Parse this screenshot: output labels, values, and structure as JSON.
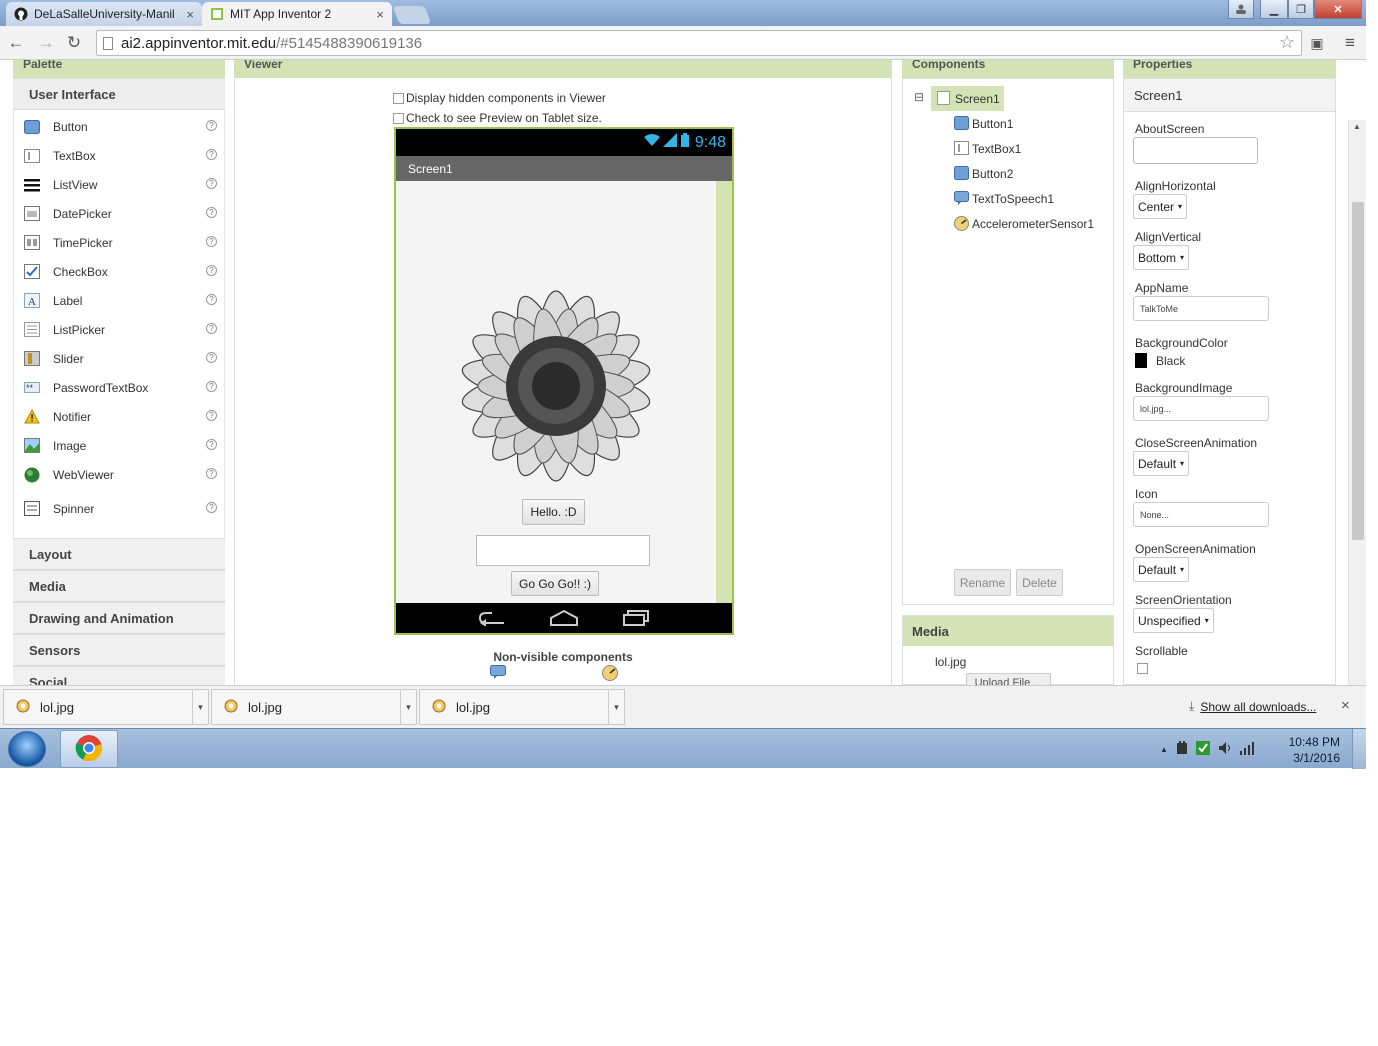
{
  "browser": {
    "tabs": [
      {
        "label": "DeLaSalleUniversity-Manil",
        "icon": "github-icon",
        "active": false
      },
      {
        "label": "MIT App Inventor 2",
        "icon": "appinventor-icon",
        "active": true
      }
    ],
    "tab_close": "×",
    "url_host": "ai2.appinventor.mit.edu",
    "url_rest": "/#5145488390619136"
  },
  "palette": {
    "title": "Palette",
    "open_category": "User Interface",
    "items": [
      {
        "label": "Button",
        "icon": "button-icon"
      },
      {
        "label": "TextBox",
        "icon": "textbox-icon"
      },
      {
        "label": "ListView",
        "icon": "listview-icon"
      },
      {
        "label": "DatePicker",
        "icon": "datepicker-icon"
      },
      {
        "label": "TimePicker",
        "icon": "timepicker-icon"
      },
      {
        "label": "CheckBox",
        "icon": "checkbox-icon"
      },
      {
        "label": "Label",
        "icon": "label-icon"
      },
      {
        "label": "ListPicker",
        "icon": "listpicker-icon"
      },
      {
        "label": "Slider",
        "icon": "slider-icon"
      },
      {
        "label": "PasswordTextBox",
        "icon": "passwordtextbox-icon"
      },
      {
        "label": "Notifier",
        "icon": "notifier-icon"
      },
      {
        "label": "Image",
        "icon": "image-icon"
      },
      {
        "label": "WebViewer",
        "icon": "webviewer-icon"
      },
      {
        "label": "Spinner",
        "icon": "spinner-icon"
      }
    ],
    "help": "?",
    "categories": [
      "Layout",
      "Media",
      "Drawing and Animation",
      "Sensors",
      "Social"
    ]
  },
  "viewer": {
    "title": "Viewer",
    "opt_hidden": "Display hidden components in Viewer",
    "opt_tablet": "Check to see Preview on Tablet size.",
    "status_time": "9:48",
    "screen_title": "Screen1",
    "button1": "Hello. :D",
    "textbox1": "",
    "button2": "Go Go Go!! :)",
    "nonvisible_title": "Non-visible components"
  },
  "components": {
    "title": "Components",
    "root": "Screen1",
    "collapse": "⊟",
    "children": [
      "Button1",
      "TextBox1",
      "Button2",
      "TextToSpeech1",
      "AccelerometerSensor1"
    ],
    "rename": "Rename",
    "delete": "Delete"
  },
  "media": {
    "title": "Media",
    "file": "lol.jpg",
    "upload": "Upload File ..."
  },
  "properties": {
    "title": "Properties",
    "component": "Screen1",
    "about_label": "AboutScreen",
    "about_value": "",
    "alignh_label": "AlignHorizontal",
    "alignh_value": "Center",
    "alignv_label": "AlignVertical",
    "alignv_value": "Bottom",
    "appname_label": "AppName",
    "appname_value": "TalkToMe",
    "bgcolor_label": "BackgroundColor",
    "bgcolor_value": "Black",
    "bgcolor_hex": "#000000",
    "bgimage_label": "BackgroundImage",
    "bgimage_value": "lol.jpg...",
    "closeanim_label": "CloseScreenAnimation",
    "closeanim_value": "Default",
    "icon_label": "Icon",
    "icon_value": "None...",
    "openanim_label": "OpenScreenAnimation",
    "openanim_value": "Default",
    "orientation_label": "ScreenOrientation",
    "orientation_value": "Unspecified",
    "scrollable_label": "Scrollable"
  },
  "downloads": {
    "items": [
      "lol.jpg",
      "lol.jpg",
      "lol.jpg"
    ],
    "show_all": "Show all downloads...",
    "close": "×"
  },
  "taskbar": {
    "time": "10:48 PM",
    "date": "3/1/2016"
  },
  "colors": {
    "panel_header": "#d3e3b5",
    "phone_border": "#9bc24a",
    "status_text": "#33b5e5"
  }
}
